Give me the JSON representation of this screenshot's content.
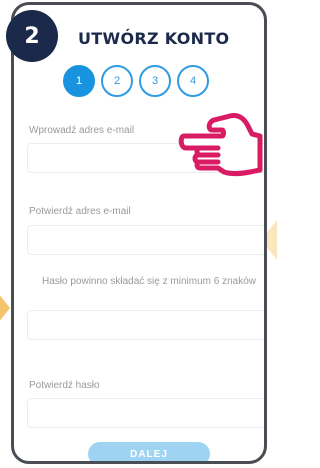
{
  "step_badge": "2",
  "title": "UTWÓRZ KONTO",
  "steps": [
    "1",
    "2",
    "3",
    "4"
  ],
  "active_step": "1",
  "form": {
    "email_label": "Wprowadź adres e-mail",
    "confirm_email_label": "Potwierdź adres e-mail",
    "password_hint": "Hasło powinno składać się z minimum 6 znaków",
    "confirm_password_label": "Potwierdź hasło",
    "email_value": "",
    "confirm_email_value": "",
    "password_value": "",
    "confirm_password_value": ""
  },
  "next_button": "DALEJ",
  "colors": {
    "brand_dark": "#1b2a4b",
    "accent_blue": "#1893df",
    "button_blue": "#9fd3f2",
    "hand_pink": "#d81b63",
    "orange": "#f3c46c"
  },
  "icons": {
    "pointer": "pointing-hand-icon"
  }
}
